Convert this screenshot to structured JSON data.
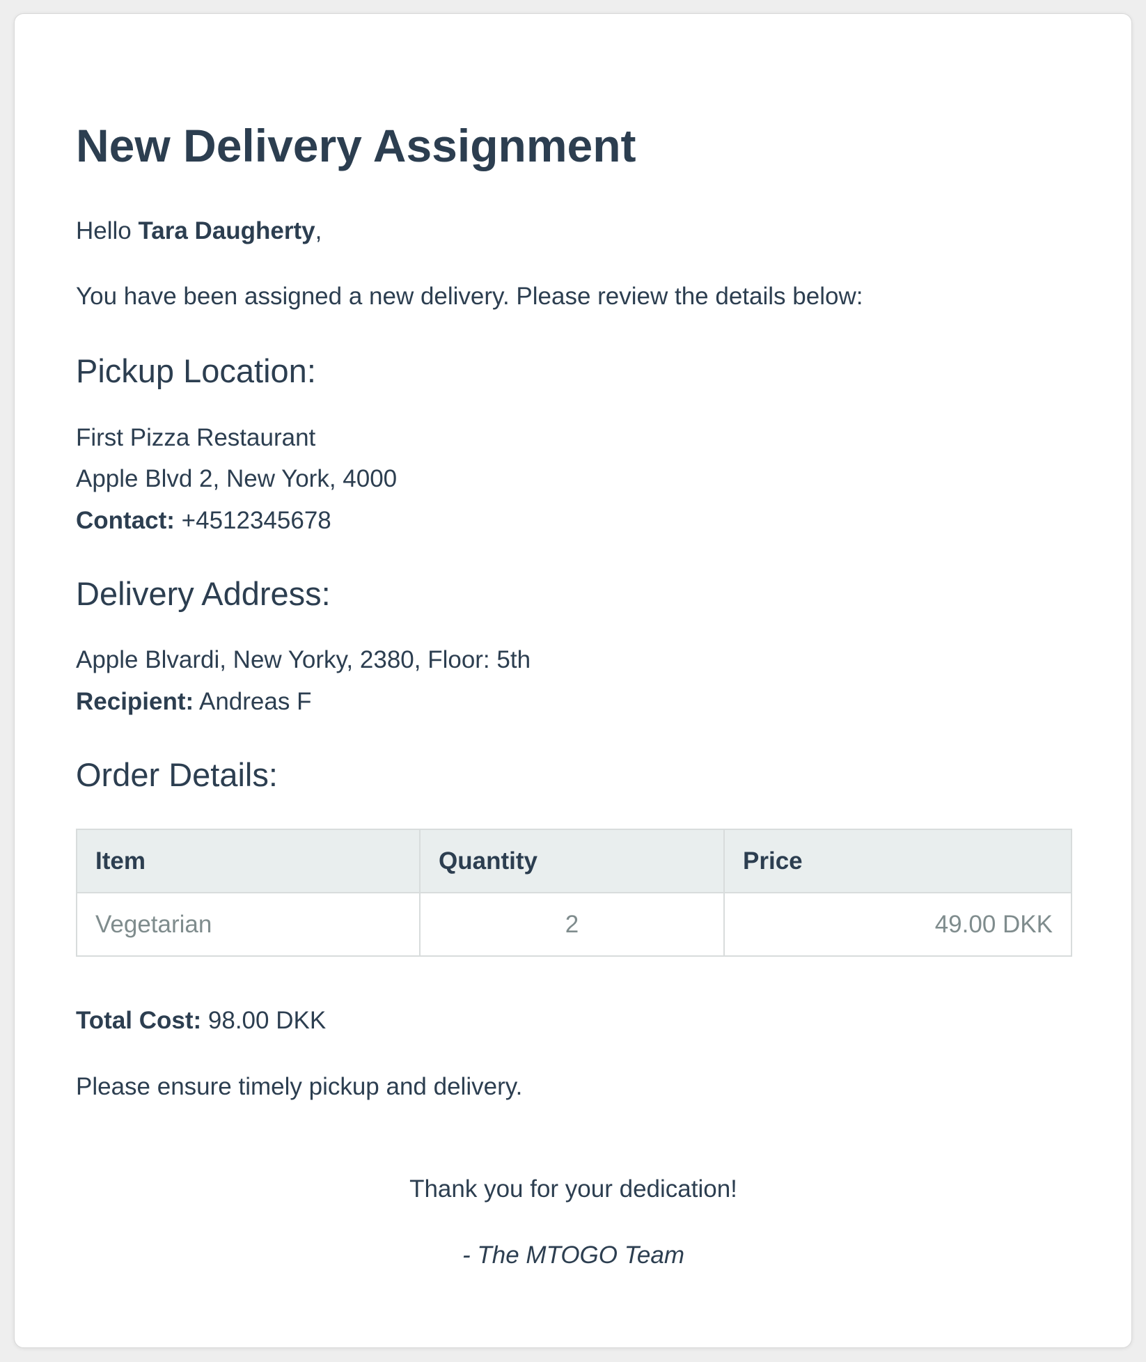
{
  "email": {
    "title": "New Delivery Assignment",
    "greeting_prefix": "Hello ",
    "recipient_name": "Tara Daugherty",
    "greeting_suffix": ",",
    "intro": "You have been assigned a new delivery. Please review the details below:",
    "pickup": {
      "heading": "Pickup Location:",
      "restaurant": "First Pizza Restaurant",
      "address": "Apple Blvd 2, New York, 4000",
      "contact_label": "Contact:",
      "contact_value": " +4512345678"
    },
    "delivery": {
      "heading": "Delivery Address:",
      "address": "Apple Blvardi, New Yorky, 2380, Floor: 5th",
      "recipient_label": "Recipient:",
      "recipient_value": " Andreas F"
    },
    "order": {
      "heading": "Order Details:",
      "columns": [
        "Item",
        "Quantity",
        "Price"
      ],
      "rows": [
        {
          "item": "Vegetarian",
          "quantity": "2",
          "price": "49.00 DKK"
        }
      ],
      "total_label": "Total Cost:",
      "total_value": " 98.00 DKK"
    },
    "reminder": "Please ensure timely pickup and delivery.",
    "thanks": "Thank you for your dedication!",
    "signature": "- The MTOGO Team"
  }
}
